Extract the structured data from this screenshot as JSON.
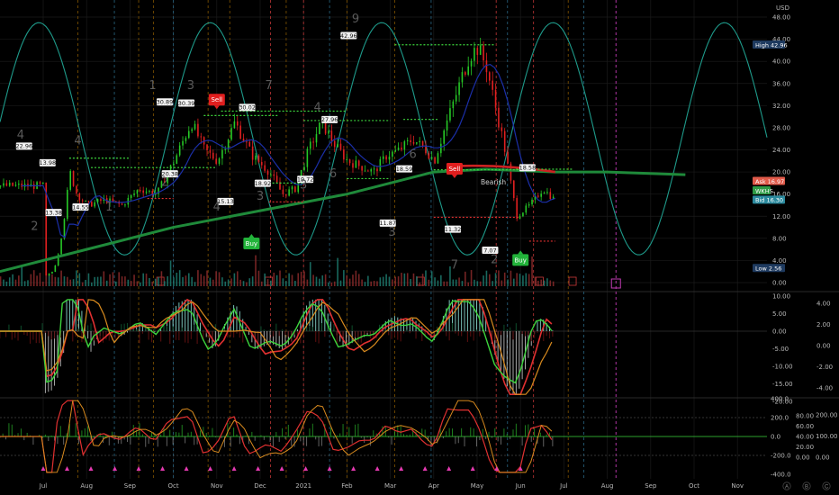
{
  "chart_data": {
    "type": "line",
    "currency": "USD",
    "x_months": [
      "Jul",
      "Aug",
      "Sep",
      "Oct",
      "Nov",
      "Dec",
      "2021",
      "Feb",
      "Mar",
      "Apr",
      "May",
      "Jun",
      "Jul",
      "Aug",
      "Sep",
      "Oct",
      "Nov"
    ],
    "price_axis": {
      "ticks": [
        "48.00",
        "44.00",
        "40.00",
        "36.00",
        "32.00",
        "28.00",
        "24.00",
        "20.00",
        "16.00",
        "12.00",
        "8.00",
        "4.00",
        "0.00"
      ],
      "ylim": [
        0,
        48
      ]
    },
    "price_series": [
      {
        "t": 0,
        "v": 1
      },
      {
        "t": 0.05,
        "v": 1.5
      },
      {
        "t": 0.1,
        "v": 2
      },
      {
        "t": 0.15,
        "v": 4
      },
      {
        "t": 0.22,
        "v": 10
      },
      {
        "t": 0.3,
        "v": 20
      },
      {
        "t": 0.38,
        "v": 16
      },
      {
        "t": 0.5,
        "v": 14
      },
      {
        "t": 0.7,
        "v": 15
      },
      {
        "t": 0.9,
        "v": 14
      },
      {
        "t": 1.1,
        "v": 17
      },
      {
        "t": 1.3,
        "v": 16
      },
      {
        "t": 1.5,
        "v": 22
      },
      {
        "t": 1.7,
        "v": 29
      },
      {
        "t": 1.85,
        "v": 24
      },
      {
        "t": 2.0,
        "v": 22
      },
      {
        "t": 2.2,
        "v": 29
      },
      {
        "t": 2.4,
        "v": 23
      },
      {
        "t": 2.6,
        "v": 20
      },
      {
        "t": 2.75,
        "v": 16
      },
      {
        "t": 2.9,
        "v": 17
      },
      {
        "t": 3.05,
        "v": 24
      },
      {
        "t": 3.2,
        "v": 29
      },
      {
        "t": 3.35,
        "v": 25
      },
      {
        "t": 3.5,
        "v": 22
      },
      {
        "t": 3.65,
        "v": 21
      },
      {
        "t": 3.8,
        "v": 20
      },
      {
        "t": 3.95,
        "v": 23
      },
      {
        "t": 4.1,
        "v": 24
      },
      {
        "t": 4.25,
        "v": 26
      },
      {
        "t": 4.4,
        "v": 24
      },
      {
        "t": 4.5,
        "v": 22
      },
      {
        "t": 4.6,
        "v": 27
      },
      {
        "t": 4.75,
        "v": 34
      },
      {
        "t": 4.9,
        "v": 41
      },
      {
        "t": 5.0,
        "v": 42.5
      },
      {
        "t": 5.1,
        "v": 39
      },
      {
        "t": 5.2,
        "v": 32
      },
      {
        "t": 5.3,
        "v": 25
      },
      {
        "t": 5.38,
        "v": 18
      },
      {
        "t": 5.45,
        "v": 12
      },
      {
        "t": 5.6,
        "v": 14
      },
      {
        "t": 5.75,
        "v": 17
      },
      {
        "t": 5.95,
        "v": 14
      },
      {
        "t": 6.1,
        "v": 12
      },
      {
        "t": 6.3,
        "v": 14
      },
      {
        "t": 6.45,
        "v": 12
      },
      {
        "t": 6.6,
        "v": 11
      },
      {
        "t": 6.75,
        "v": 12
      },
      {
        "t": 6.9,
        "v": 9
      },
      {
        "t": 7.05,
        "v": 7
      },
      {
        "t": 7.15,
        "v": 8
      },
      {
        "t": 7.3,
        "v": 10
      },
      {
        "t": 7.4,
        "v": 15
      },
      {
        "t": 7.5,
        "v": 18
      },
      {
        "t": 7.6,
        "v": 16
      },
      {
        "t": 7.7,
        "v": 15
      },
      {
        "t": 7.8,
        "v": 15.5
      },
      {
        "t": 7.9,
        "v": 17.5
      }
    ],
    "ma_long": [
      {
        "t": 0,
        "v": 2
      },
      {
        "t": 1,
        "v": 6
      },
      {
        "t": 2,
        "v": 10
      },
      {
        "t": 3,
        "v": 13
      },
      {
        "t": 4,
        "v": 16
      },
      {
        "t": 5,
        "v": 20
      },
      {
        "t": 5.6,
        "v": 20.5
      },
      {
        "t": 6.4,
        "v": 20
      },
      {
        "t": 7,
        "v": 20
      },
      {
        "t": 7.9,
        "v": 19.5
      }
    ],
    "cycle_peaks_t": [
      0,
      3.95,
      7.9
    ],
    "cycle_troughs_t": [
      1.95,
      5.9
    ],
    "price_labels": [
      {
        "text": "22.96",
        "t": 0.28,
        "v": 24.5
      },
      {
        "text": "13.98",
        "t": 0.55,
        "v": 21.5
      },
      {
        "text": "13.38",
        "t": 0.62,
        "v": 12.5
      },
      {
        "text": "14.55",
        "t": 0.93,
        "v": 13.5
      },
      {
        "text": "30.89",
        "t": 1.9,
        "v": 32.5
      },
      {
        "text": "30.39",
        "t": 2.15,
        "v": 32.3
      },
      {
        "text": "20.38",
        "t": 1.96,
        "v": 19.5
      },
      {
        "text": "30.02",
        "t": 2.85,
        "v": 31.5
      },
      {
        "text": "15.13",
        "t": 2.6,
        "v": 14.5
      },
      {
        "text": "18.92",
        "t": 3.03,
        "v": 17.8
      },
      {
        "text": "19.72",
        "t": 3.52,
        "v": 18.5
      },
      {
        "text": "27.96",
        "t": 3.8,
        "v": 29.3
      },
      {
        "text": "42.96",
        "t": 4.02,
        "v": 44.5
      },
      {
        "text": "18.59",
        "t": 4.66,
        "v": 20.4
      },
      {
        "text": "11.87",
        "t": 4.47,
        "v": 10.6
      },
      {
        "text": "11.32",
        "t": 5.22,
        "v": 9.5
      },
      {
        "text": "7.07",
        "t": 5.65,
        "v": 5.7
      },
      {
        "text": "18.58",
        "t": 6.08,
        "v": 20.6
      }
    ],
    "wave_labels": [
      {
        "text": "4",
        "t": 0.12,
        "v": 26
      },
      {
        "text": "2",
        "t": 0.2,
        "v": 9.5
      },
      {
        "text": "4",
        "t": 0.45,
        "v": 25
      },
      {
        "text": "1",
        "t": 0.63,
        "v": 13
      },
      {
        "text": "1",
        "t": 0.88,
        "v": 35
      },
      {
        "text": "3",
        "t": 1.1,
        "v": 35
      },
      {
        "text": "2",
        "t": 0.95,
        "v": 17.5
      },
      {
        "text": "4",
        "t": 1.25,
        "v": 13
      },
      {
        "text": "7",
        "t": 1.55,
        "v": 35
      },
      {
        "text": "3",
        "t": 1.5,
        "v": 15
      },
      {
        "text": "3",
        "t": 1.75,
        "v": 17
      },
      {
        "text": "4",
        "t": 1.83,
        "v": 31
      },
      {
        "text": "6",
        "t": 1.92,
        "v": 19
      },
      {
        "text": "9",
        "t": 2.05,
        "v": 47
      },
      {
        "text": "6",
        "t": 2.38,
        "v": 22.5
      },
      {
        "text": "3",
        "t": 2.26,
        "v": 8.5
      },
      {
        "text": "7",
        "t": 2.62,
        "v": 2.5
      },
      {
        "text": "2",
        "t": 2.85,
        "v": 3.5
      }
    ],
    "signals": [
      {
        "label": "Sell",
        "kind": "sell",
        "t": 1.25,
        "v": 33
      },
      {
        "label": "Buy",
        "kind": "buy",
        "t": 1.45,
        "v": 7
      },
      {
        "label": "Sell",
        "kind": "sell",
        "t": 2.62,
        "v": 20.5
      },
      {
        "label": "Buy",
        "kind": "buy",
        "t": 3.0,
        "v": 4
      }
    ],
    "annotation": "Bearish",
    "right_tags": [
      {
        "label": "High",
        "value": "42.96",
        "v": 42.96,
        "bg": "#1e3a5f"
      },
      {
        "label": "Ask",
        "value": "16.97",
        "v": 18.3,
        "bg": "#e05a4a"
      },
      {
        "label": "WKHS",
        "value": "",
        "v": 16.6,
        "bg": "#2e9a46"
      },
      {
        "label": "Bid",
        "value": "16.30",
        "v": 14.9,
        "bg": "#2b8a9e"
      },
      {
        "label": "Low",
        "value": "2.56",
        "v": 2.56,
        "bg": "#1e3a5f"
      }
    ],
    "osc1_axis": {
      "left_ticks": [
        "10.00",
        "5.00",
        "0.00",
        "-5.00",
        "-10.00",
        "-15.00",
        "-20.00"
      ],
      "right_ticks": [
        "4.00",
        "2.00",
        "0.00",
        "-2.00",
        "-4.00"
      ],
      "left_values": [
        10,
        5,
        0,
        -5,
        -10,
        -15,
        -20
      ],
      "right_values": [
        4,
        2,
        0,
        -2,
        -4
      ]
    },
    "osc2_axis": {
      "left_ticks": [
        "400.0",
        "200.0",
        "0.0",
        "-200.0",
        "-400.0"
      ],
      "mid_ticks": [
        "80.00",
        "60.00",
        "40.00",
        "20.00",
        "0.00"
      ],
      "right_ticks": [
        "200.00",
        "100.00",
        "0.00"
      ],
      "left_values": [
        400,
        200,
        0,
        -200,
        -400
      ],
      "mid_values": [
        80,
        60,
        40,
        20,
        0
      ],
      "right_values": [
        200,
        100,
        0
      ]
    },
    "corner_buttons": [
      "A",
      "B",
      "C"
    ],
    "colors": {
      "up": "#26c926",
      "down": "#e02020",
      "ma_long": "#1f8a3a",
      "ma_red": "#cc2222",
      "cycle": "#1e9a8a",
      "grid": "#1b1b1b",
      "sell": "#e01e1e",
      "buy": "#22b33a"
    }
  }
}
